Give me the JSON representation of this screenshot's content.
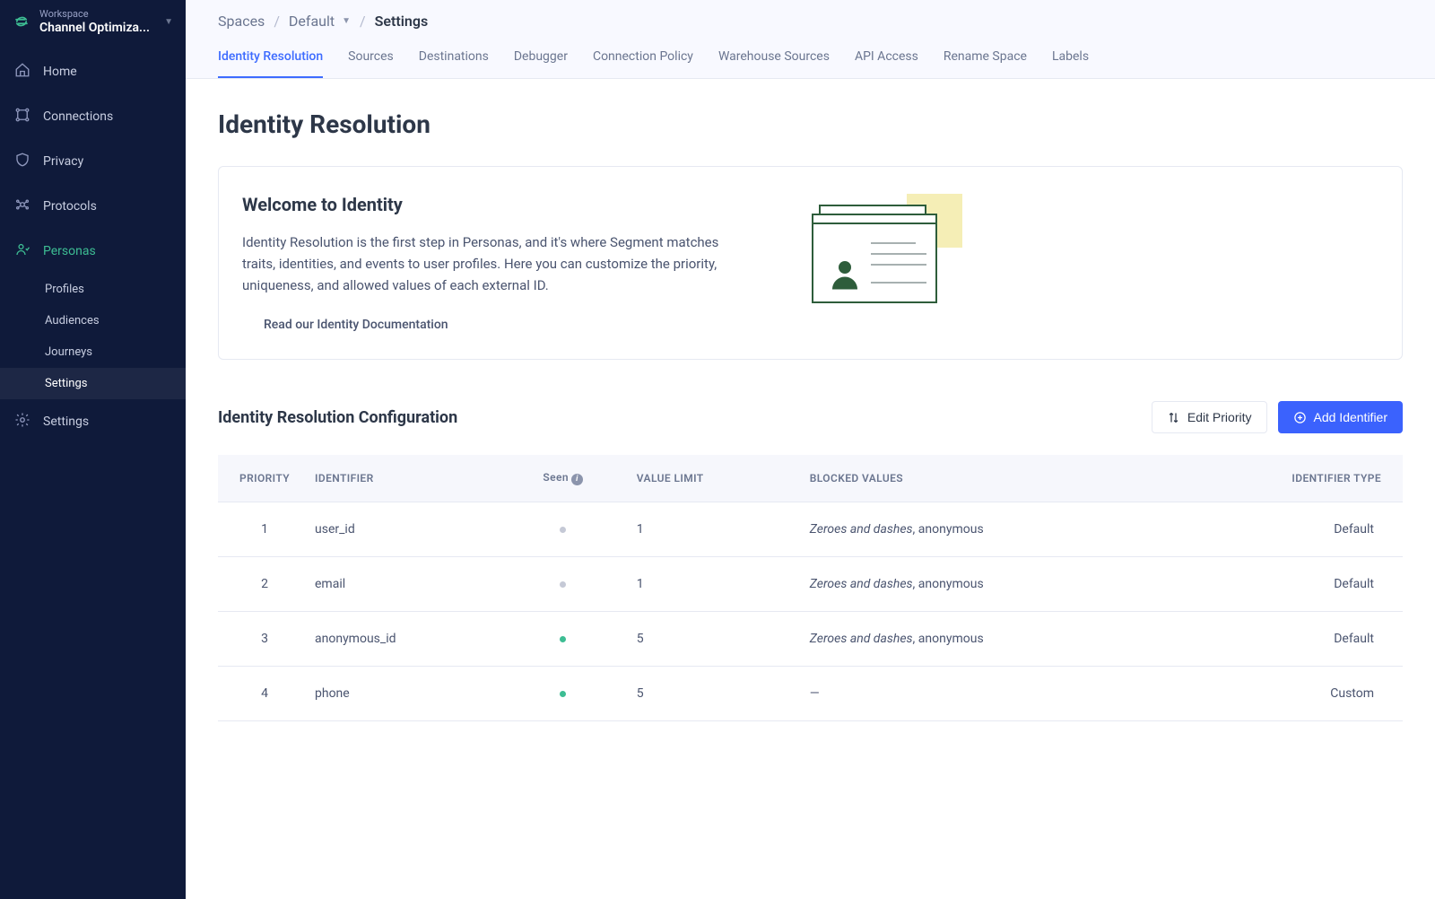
{
  "workspace": {
    "label": "Workspace",
    "name": "Channel Optimiza..."
  },
  "sidebar": {
    "items": [
      {
        "label": "Home"
      },
      {
        "label": "Connections"
      },
      {
        "label": "Privacy"
      },
      {
        "label": "Protocols"
      },
      {
        "label": "Personas"
      },
      {
        "label": "Settings"
      }
    ],
    "personasSub": [
      {
        "label": "Profiles"
      },
      {
        "label": "Audiences"
      },
      {
        "label": "Journeys"
      },
      {
        "label": "Settings"
      }
    ]
  },
  "breadcrumbs": {
    "spaces": "Spaces",
    "space": "Default",
    "current": "Settings",
    "sep": "/"
  },
  "tabs": [
    {
      "label": "Identity Resolution"
    },
    {
      "label": "Sources"
    },
    {
      "label": "Destinations"
    },
    {
      "label": "Debugger"
    },
    {
      "label": "Connection Policy"
    },
    {
      "label": "Warehouse Sources"
    },
    {
      "label": "API Access"
    },
    {
      "label": "Rename Space"
    },
    {
      "label": "Labels"
    }
  ],
  "page": {
    "title": "Identity Resolution"
  },
  "welcome": {
    "heading": "Welcome to Identity",
    "body": "Identity Resolution is the first step in Personas, and it's where Segment matches traits, identities, and events to user profiles. Here you can customize the priority, uniqueness, and allowed values of each external ID.",
    "docLink": "Read our Identity Documentation"
  },
  "config": {
    "heading": "Identity Resolution Configuration",
    "editPriority": "Edit Priority",
    "addIdentifier": "Add Identifier"
  },
  "table": {
    "headers": {
      "priority": "Priority",
      "identifier": "Identifier",
      "seen": "Seen",
      "valueLimit": "Value Limit",
      "blockedValues": "Blocked Values",
      "identifierType": "Identifier Type"
    },
    "rows": [
      {
        "priority": "1",
        "identifier": "user_id",
        "seen": "grey",
        "valueLimit": "1",
        "blockedItalic": "Zeroes and dashes",
        "blockedRest": ", anonymous",
        "type": "Default"
      },
      {
        "priority": "2",
        "identifier": "email",
        "seen": "grey",
        "valueLimit": "1",
        "blockedItalic": "Zeroes and dashes",
        "blockedRest": ", anonymous",
        "type": "Default"
      },
      {
        "priority": "3",
        "identifier": "anonymous_id",
        "seen": "green",
        "valueLimit": "5",
        "blockedItalic": "Zeroes and dashes",
        "blockedRest": ", anonymous",
        "type": "Default"
      },
      {
        "priority": "4",
        "identifier": "phone",
        "seen": "green",
        "valueLimit": "5",
        "blockedItalic": "",
        "blockedRest": "—",
        "type": "Custom"
      }
    ]
  }
}
